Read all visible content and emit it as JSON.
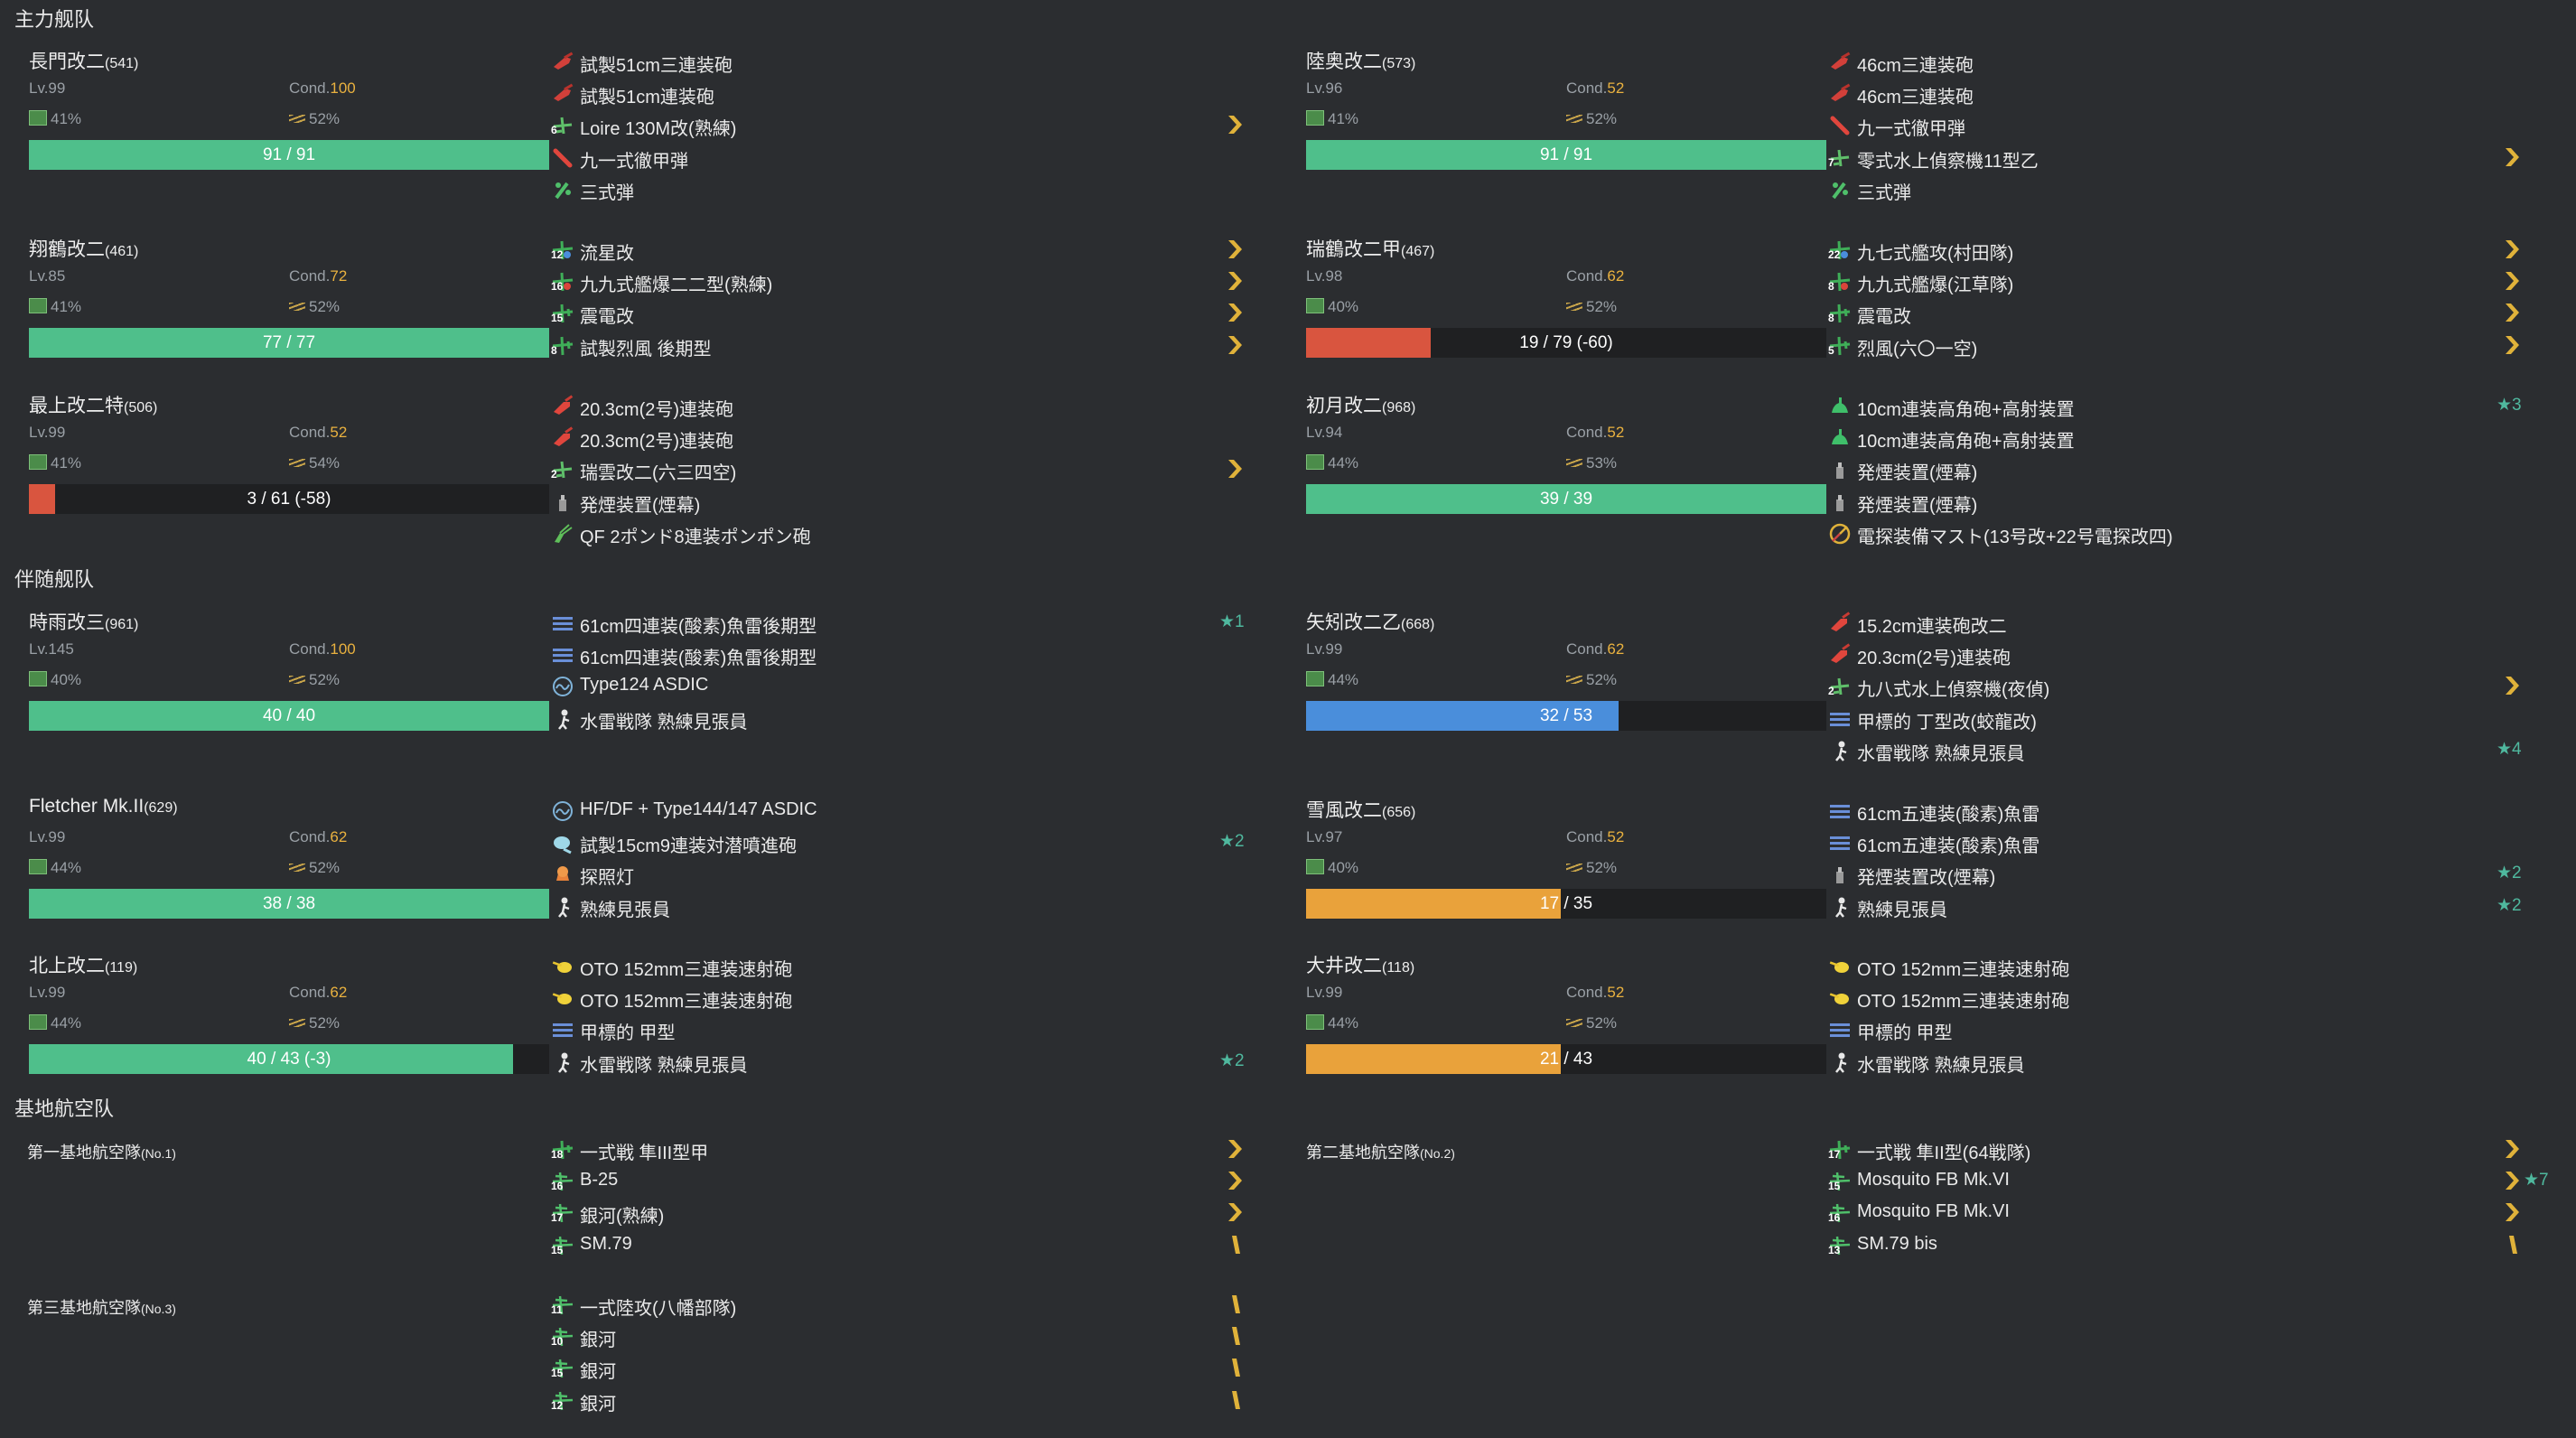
{
  "colors": {
    "green": "#4fbf8b",
    "red": "#d9553f",
    "blue": "#4a8edb",
    "orange": "#e9a23b",
    "bg": "#2b2d30",
    "cond_yellow": "#e9b13f",
    "star": "#4fb89e",
    "chevron": "#e9b13f"
  },
  "sections": {
    "main": "主力舰队",
    "escort": "伴随舰队",
    "base": "基地航空队"
  },
  "main_fleet": [
    {
      "name": "長門改二",
      "id": "(541)",
      "lv": "Lv.99",
      "cond_label": "Cond.",
      "cond": "100",
      "fuel": "41%",
      "ammo": "52%",
      "hp": "91 / 91",
      "hp_ratio": 1.0,
      "hp_color": "green",
      "equips": [
        {
          "icon": "main-gun-icon",
          "name": "試製51cm三連装砲"
        },
        {
          "icon": "main-gun-icon",
          "name": "試製51cm連装砲"
        },
        {
          "icon": "seaplane-icon",
          "name": "Loire 130M改(熟練)",
          "prof": "6",
          "chevron": true
        },
        {
          "icon": "ap-shell-icon",
          "name": "九一式徹甲弾"
        },
        {
          "icon": "sanshiki-icon",
          "name": "三式弾"
        }
      ]
    },
    {
      "name": "陸奥改二",
      "id": "(573)",
      "lv": "Lv.96",
      "cond_label": "Cond.",
      "cond": "52",
      "fuel": "41%",
      "ammo": "52%",
      "hp": "91 / 91",
      "hp_ratio": 1.0,
      "hp_color": "green",
      "equips": [
        {
          "icon": "main-gun-icon",
          "name": "46cm三連装砲"
        },
        {
          "icon": "main-gun-icon",
          "name": "46cm三連装砲"
        },
        {
          "icon": "ap-shell-icon",
          "name": "九一式徹甲弾"
        },
        {
          "icon": "seaplane-icon",
          "name": "零式水上偵察機11型乙",
          "prof": "7",
          "chevron": true
        },
        {
          "icon": "sanshiki-icon",
          "name": "三式弾"
        }
      ]
    },
    {
      "name": "翔鶴改二",
      "id": "(461)",
      "lv": "Lv.85",
      "cond_label": "Cond.",
      "cond": "72",
      "fuel": "41%",
      "ammo": "52%",
      "hp": "77 / 77",
      "hp_ratio": 1.0,
      "hp_color": "green",
      "equips": [
        {
          "icon": "torpedo-bomber-icon",
          "name": "流星改",
          "prof": "12",
          "chevron": true
        },
        {
          "icon": "dive-bomber-icon",
          "name": "九九式艦爆二二型(熟練)",
          "prof": "16",
          "chevron": true
        },
        {
          "icon": "fighter-icon",
          "name": "震電改",
          "prof": "15",
          "chevron": true
        },
        {
          "icon": "fighter-icon",
          "name": "試製烈風 後期型",
          "prof": "8",
          "chevron": true
        }
      ]
    },
    {
      "name": "瑞鶴改二甲",
      "id": "(467)",
      "lv": "Lv.98",
      "cond_label": "Cond.",
      "cond": "62",
      "fuel": "40%",
      "ammo": "52%",
      "hp": "19 / 79 (-60)",
      "hp_ratio": 0.24,
      "hp_color": "red",
      "equips": [
        {
          "icon": "torpedo-bomber-icon",
          "name": "九七式艦攻(村田隊)",
          "prof": "22",
          "chevron": true
        },
        {
          "icon": "dive-bomber-icon",
          "name": "九九式艦爆(江草隊)",
          "prof": "8",
          "chevron": true
        },
        {
          "icon": "fighter-icon",
          "name": "震電改",
          "prof": "8",
          "chevron": true
        },
        {
          "icon": "fighter-icon",
          "name": "烈風(六〇一空)",
          "prof": "5",
          "chevron": true
        }
      ]
    },
    {
      "name": "最上改二特",
      "id": "(506)",
      "lv": "Lv.99",
      "cond_label": "Cond.",
      "cond": "52",
      "fuel": "41%",
      "ammo": "54%",
      "hp": "3 / 61 (-58)",
      "hp_ratio": 0.05,
      "hp_color": "red",
      "equips": [
        {
          "icon": "medium-gun-icon",
          "name": "20.3cm(2号)連装砲"
        },
        {
          "icon": "medium-gun-icon",
          "name": "20.3cm(2号)連装砲"
        },
        {
          "icon": "seaplane-icon",
          "name": "瑞雲改二(六三四空)",
          "prof": "2",
          "chevron": true
        },
        {
          "icon": "smoke-icon",
          "name": "発煙装置(煙幕)"
        },
        {
          "icon": "aa-gun-icon",
          "name": "QF 2ポンド8連装ポンポン砲"
        }
      ]
    },
    {
      "name": "初月改二",
      "id": "(968)",
      "lv": "Lv.94",
      "cond_label": "Cond.",
      "cond": "52",
      "fuel": "44%",
      "ammo": "53%",
      "hp": "39 / 39",
      "hp_ratio": 1.0,
      "hp_color": "green",
      "equips": [
        {
          "icon": "ha-gun-icon",
          "name": "10cm連装高角砲+高射装置",
          "star": "★3"
        },
        {
          "icon": "ha-gun-icon",
          "name": "10cm連装高角砲+高射装置"
        },
        {
          "icon": "smoke-icon",
          "name": "発煙装置(煙幕)"
        },
        {
          "icon": "smoke-icon",
          "name": "発煙装置(煙幕)"
        },
        {
          "icon": "radar-icon",
          "name": "電探装備マスト(13号改+22号電探改四)"
        }
      ]
    }
  ],
  "escort_fleet": [
    {
      "name": "時雨改三",
      "id": "(961)",
      "lv": "Lv.145",
      "cond_label": "Cond.",
      "cond": "100",
      "fuel": "40%",
      "ammo": "52%",
      "hp": "40 / 40",
      "hp_ratio": 1.0,
      "hp_color": "green",
      "equips": [
        {
          "icon": "torpedo-icon",
          "name": "61cm四連装(酸素)魚雷後期型",
          "star": "★1"
        },
        {
          "icon": "torpedo-icon",
          "name": "61cm四連装(酸素)魚雷後期型"
        },
        {
          "icon": "sonar-icon",
          "name": "Type124 ASDIC"
        },
        {
          "icon": "lookout-icon",
          "name": "水雷戦隊 熟練見張員"
        }
      ]
    },
    {
      "name": "矢矧改二乙",
      "id": "(668)",
      "lv": "Lv.99",
      "cond_label": "Cond.",
      "cond": "62",
      "fuel": "44%",
      "ammo": "52%",
      "hp": "32 / 53",
      "hp_ratio": 0.6,
      "hp_color": "blue",
      "equips": [
        {
          "icon": "medium-gun-icon",
          "name": "15.2cm連装砲改二"
        },
        {
          "icon": "medium-gun-icon",
          "name": "20.3cm(2号)連装砲"
        },
        {
          "icon": "seaplane-icon",
          "name": "九八式水上偵察機(夜偵)",
          "prof": "2",
          "chevron": true
        },
        {
          "icon": "torpedo-icon",
          "name": "甲標的 丁型改(蛟龍改)"
        },
        {
          "icon": "lookout-icon",
          "name": "水雷戦隊 熟練見張員",
          "star": "★4"
        }
      ]
    },
    {
      "name": "Fletcher Mk.II",
      "id": "(629)",
      "lv": "Lv.99",
      "cond_label": "Cond.",
      "cond": "62",
      "fuel": "44%",
      "ammo": "52%",
      "hp": "38 / 38",
      "hp_ratio": 1.0,
      "hp_color": "green",
      "equips": [
        {
          "icon": "sonar-icon",
          "name": "HF/DF + Type144/147 ASDIC"
        },
        {
          "icon": "asw-gun-icon",
          "name": "試製15cm9連装対潜噴進砲",
          "star": "★2"
        },
        {
          "icon": "searchlight-icon",
          "name": "探照灯"
        },
        {
          "icon": "lookout-icon",
          "name": "熟練見張員"
        }
      ]
    },
    {
      "name": "雪風改二",
      "id": "(656)",
      "lv": "Lv.97",
      "cond_label": "Cond.",
      "cond": "52",
      "fuel": "40%",
      "ammo": "52%",
      "hp": "17 / 35",
      "hp_ratio": 0.49,
      "hp_color": "orange",
      "equips": [
        {
          "icon": "torpedo-icon",
          "name": "61cm五連装(酸素)魚雷"
        },
        {
          "icon": "torpedo-icon",
          "name": "61cm五連装(酸素)魚雷"
        },
        {
          "icon": "smoke-icon",
          "name": "発煙装置改(煙幕)",
          "star": "★2"
        },
        {
          "icon": "lookout-icon",
          "name": "熟練見張員",
          "star": "★2"
        }
      ]
    },
    {
      "name": "北上改二",
      "id": "(119)",
      "lv": "Lv.99",
      "cond_label": "Cond.",
      "cond": "62",
      "fuel": "44%",
      "ammo": "52%",
      "hp": "40 / 43 (-3)",
      "hp_ratio": 0.93,
      "hp_color": "green",
      "equips": [
        {
          "icon": "secondary-gun-icon",
          "name": "OTO 152mm三連装速射砲"
        },
        {
          "icon": "secondary-gun-icon",
          "name": "OTO 152mm三連装速射砲"
        },
        {
          "icon": "torpedo-icon",
          "name": "甲標的 甲型"
        },
        {
          "icon": "lookout-icon",
          "name": "水雷戦隊 熟練見張員",
          "star": "★2"
        }
      ]
    },
    {
      "name": "大井改二",
      "id": "(118)",
      "lv": "Lv.99",
      "cond_label": "Cond.",
      "cond": "52",
      "fuel": "44%",
      "ammo": "52%",
      "hp": "21 / 43",
      "hp_ratio": 0.49,
      "hp_color": "orange",
      "equips": [
        {
          "icon": "secondary-gun-icon",
          "name": "OTO 152mm三連装速射砲"
        },
        {
          "icon": "secondary-gun-icon",
          "name": "OTO 152mm三連装速射砲"
        },
        {
          "icon": "torpedo-icon",
          "name": "甲標的 甲型"
        },
        {
          "icon": "lookout-icon",
          "name": "水雷戦隊 熟練見張員"
        }
      ]
    }
  ],
  "bases": [
    {
      "name": "第一基地航空隊",
      "id": "(No.1)",
      "equips": [
        {
          "icon": "fighter-icon",
          "name": "一式戦 隼III型甲",
          "prof": "18",
          "chevron": true
        },
        {
          "icon": "land-bomber-icon",
          "name": "B-25",
          "prof": "16",
          "chevron": true
        },
        {
          "icon": "land-bomber-icon",
          "name": "銀河(熟練)",
          "prof": "17",
          "chevron": true
        },
        {
          "icon": "land-bomber-icon",
          "name": "SM.79",
          "prof": "15",
          "bar": true
        }
      ]
    },
    {
      "name": "第二基地航空隊",
      "id": "(No.2)",
      "equips": [
        {
          "icon": "fighter-icon",
          "name": "一式戦 隼II型(64戦隊)",
          "prof": "17",
          "chevron": true
        },
        {
          "icon": "land-bomber-icon",
          "name": "Mosquito FB Mk.VI",
          "prof": "15",
          "chevron": true,
          "star": "★7"
        },
        {
          "icon": "land-bomber-icon",
          "name": "Mosquito FB Mk.VI",
          "prof": "16",
          "chevron": true
        },
        {
          "icon": "land-bomber-icon",
          "name": "SM.79 bis",
          "prof": "13",
          "bar": true
        }
      ]
    },
    {
      "name": "第三基地航空隊",
      "id": "(No.3)",
      "equips": [
        {
          "icon": "land-bomber-icon",
          "name": "一式陸攻(八幡部隊)",
          "prof": "11",
          "bar": true
        },
        {
          "icon": "land-bomber-icon",
          "name": "銀河",
          "prof": "10",
          "bar": true
        },
        {
          "icon": "land-bomber-icon",
          "name": "銀河",
          "prof": "15",
          "bar": true
        },
        {
          "icon": "land-bomber-icon",
          "name": "銀河",
          "prof": "12",
          "bar": true
        }
      ]
    }
  ]
}
